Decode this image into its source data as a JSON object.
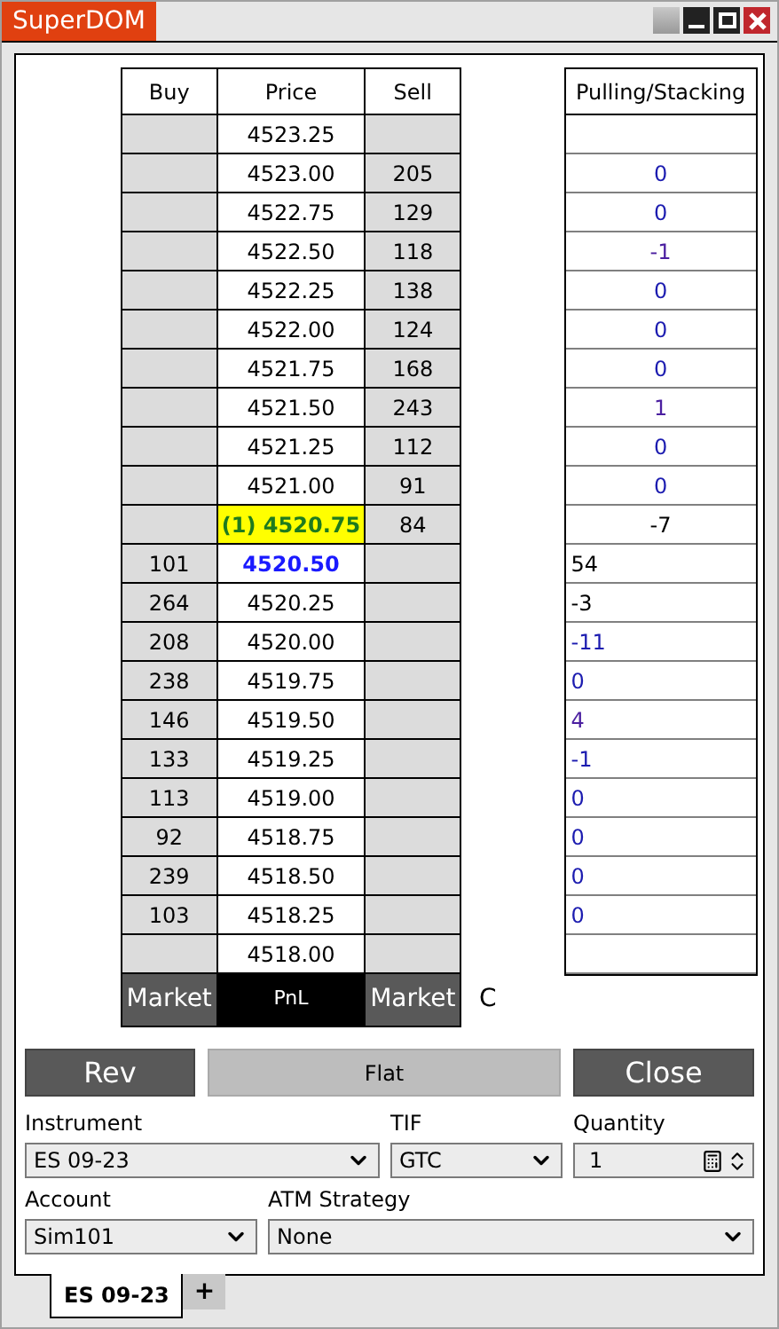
{
  "window": {
    "title": "SuperDOM"
  },
  "ladder": {
    "columns": [
      "Buy",
      "Price",
      "Sell"
    ],
    "rows": [
      {
        "buy": "",
        "price": "4523.25",
        "sell": "",
        "kind": "normal"
      },
      {
        "buy": "",
        "price": "4523.00",
        "sell": "205",
        "kind": "normal"
      },
      {
        "buy": "",
        "price": "4522.75",
        "sell": "129",
        "kind": "normal"
      },
      {
        "buy": "",
        "price": "4522.50",
        "sell": "118",
        "kind": "normal"
      },
      {
        "buy": "",
        "price": "4522.25",
        "sell": "138",
        "kind": "normal"
      },
      {
        "buy": "",
        "price": "4522.00",
        "sell": "124",
        "kind": "normal"
      },
      {
        "buy": "",
        "price": "4521.75",
        "sell": "168",
        "kind": "normal"
      },
      {
        "buy": "",
        "price": "4521.50",
        "sell": "243",
        "kind": "normal"
      },
      {
        "buy": "",
        "price": "4521.25",
        "sell": "112",
        "kind": "normal"
      },
      {
        "buy": "",
        "price": "4521.00",
        "sell": "91",
        "kind": "normal"
      },
      {
        "buy": "",
        "price": "(1) 4520.75",
        "sell": "84",
        "kind": "position"
      },
      {
        "buy": "101",
        "price": "4520.50",
        "sell": "",
        "kind": "last"
      },
      {
        "buy": "264",
        "price": "4520.25",
        "sell": "",
        "kind": "normal"
      },
      {
        "buy": "208",
        "price": "4520.00",
        "sell": "",
        "kind": "normal"
      },
      {
        "buy": "238",
        "price": "4519.75",
        "sell": "",
        "kind": "normal"
      },
      {
        "buy": "146",
        "price": "4519.50",
        "sell": "",
        "kind": "normal"
      },
      {
        "buy": "133",
        "price": "4519.25",
        "sell": "",
        "kind": "normal"
      },
      {
        "buy": "113",
        "price": "4519.00",
        "sell": "",
        "kind": "normal"
      },
      {
        "buy": "92",
        "price": "4518.75",
        "sell": "",
        "kind": "normal"
      },
      {
        "buy": "239",
        "price": "4518.50",
        "sell": "",
        "kind": "normal"
      },
      {
        "buy": "103",
        "price": "4518.25",
        "sell": "",
        "kind": "normal"
      },
      {
        "buy": "",
        "price": "4518.00",
        "sell": "",
        "kind": "normal"
      }
    ],
    "footer": {
      "buy": "Market",
      "price": "PnL",
      "sell": "Market"
    },
    "side_label": "C"
  },
  "pulling_stacking": {
    "title": "Pulling/Stacking",
    "rows": [
      {
        "value": "",
        "kind": "ask"
      },
      {
        "value": "0",
        "kind": "ask",
        "color": "#1c1cb0"
      },
      {
        "value": "0",
        "kind": "ask",
        "color": "#1c1cb0"
      },
      {
        "value": "-1",
        "kind": "ask",
        "color": "#4b1fa0"
      },
      {
        "value": "0",
        "kind": "ask",
        "color": "#1c1cb0"
      },
      {
        "value": "0",
        "kind": "ask",
        "color": "#1c1cb0"
      },
      {
        "value": "0",
        "kind": "ask",
        "color": "#1c1cb0"
      },
      {
        "value": "1",
        "kind": "ask",
        "color": "#4b1fa0"
      },
      {
        "value": "0",
        "kind": "ask",
        "color": "#1c1cb0"
      },
      {
        "value": "0",
        "kind": "ask",
        "color": "#1c1cb0"
      },
      {
        "value": "-7",
        "kind": "ask",
        "color": "#000000"
      },
      {
        "value": "54",
        "kind": "bid",
        "color": "#000000"
      },
      {
        "value": "-3",
        "kind": "bid",
        "color": "#000000"
      },
      {
        "value": "-11",
        "kind": "bid",
        "color": "#1c1cb0"
      },
      {
        "value": "0",
        "kind": "bid",
        "color": "#1c1cb0"
      },
      {
        "value": "4",
        "kind": "bid",
        "color": "#4b1fa0"
      },
      {
        "value": "-1",
        "kind": "bid",
        "color": "#1c1cb0"
      },
      {
        "value": "0",
        "kind": "bid",
        "color": "#1c1cb0"
      },
      {
        "value": "0",
        "kind": "bid",
        "color": "#1c1cb0"
      },
      {
        "value": "0",
        "kind": "bid",
        "color": "#1c1cb0"
      },
      {
        "value": "0",
        "kind": "bid",
        "color": "#1c1cb0"
      },
      {
        "value": "",
        "kind": "bid"
      }
    ]
  },
  "buttons": [
    {
      "label": "Rev",
      "kind": "dark"
    },
    {
      "label": "Flat",
      "kind": "light"
    },
    {
      "label": "Close",
      "kind": "dark"
    }
  ],
  "fields": {
    "instrument": {
      "label": "Instrument",
      "value": "ES 09-23"
    },
    "tif": {
      "label": "TIF",
      "value": "GTC"
    },
    "quantity": {
      "label": "Quantity",
      "value": "1"
    },
    "account": {
      "label": "Account",
      "value": "Sim101"
    },
    "atm_strategy": {
      "label": "ATM Strategy",
      "value": "None"
    }
  },
  "tabs": [
    {
      "label": "ES 09-23",
      "selected": true
    },
    {
      "label": "+",
      "selected": false
    }
  ]
}
